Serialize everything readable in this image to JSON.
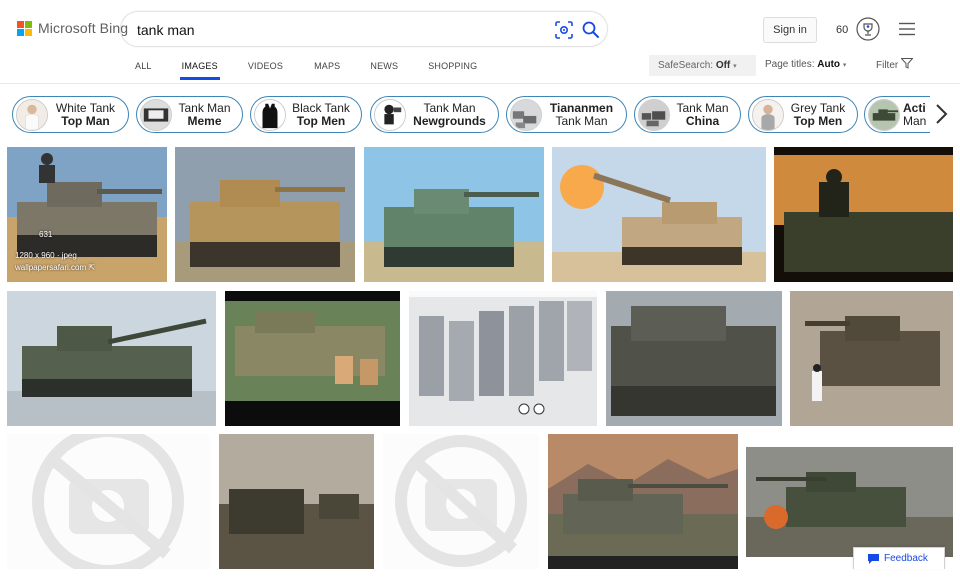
{
  "brand": {
    "logo_text": "Microsoft Bing",
    "colors": {
      "red": "#f35325",
      "green": "#81bc06",
      "blue": "#05a6f0",
      "yellow": "#ffba08"
    }
  },
  "search": {
    "query": "tank man",
    "visual_search_icon": "camera-scan-icon",
    "search_icon": "search-icon"
  },
  "header": {
    "sign_in_label": "Sign in",
    "points": "60",
    "rewards_icon": "trophy-icon",
    "menu_icon": "hamburger-menu-icon"
  },
  "tabs": [
    {
      "label": "ALL"
    },
    {
      "label": "IMAGES"
    },
    {
      "label": "VIDEOS"
    },
    {
      "label": "MAPS"
    },
    {
      "label": "NEWS"
    },
    {
      "label": "SHOPPING"
    }
  ],
  "filters": {
    "safesearch_label": "SafeSearch:",
    "safesearch_value": "Off",
    "page_titles_label": "Page titles:",
    "page_titles_value": "Auto",
    "filter_label": "Filter"
  },
  "chips": [
    {
      "line1": "White Tank",
      "line2": "Top Man"
    },
    {
      "line1": "Tank Man",
      "line2": "Meme"
    },
    {
      "line1": "Black Tank",
      "line2": "Top Men"
    },
    {
      "line1": "Tank Man",
      "line2": "Newgrounds"
    },
    {
      "line1": "Tiananmen",
      "line2": "Tank Man"
    },
    {
      "line1": "Tank Man",
      "line2": "China"
    },
    {
      "line1": "Grey Tank",
      "line2": "Top Men"
    },
    {
      "line1": "Acti",
      "line2": "Man"
    }
  ],
  "results": {
    "first_image": {
      "count": "631",
      "dims": "1280 x 960 · jpeg",
      "source": "wallpapersafari.com"
    }
  },
  "feedback_label": "Feedback",
  "accent_color": "#174ae4",
  "chip_border_color": "#3f86b8"
}
